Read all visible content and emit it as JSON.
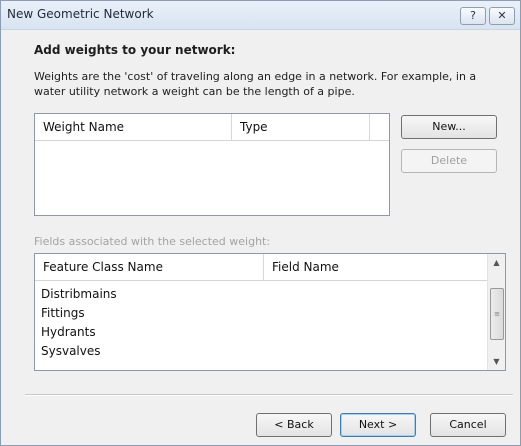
{
  "window": {
    "title": "New Geometric Network",
    "help_icon": "?",
    "close_icon": "✕"
  },
  "weights_section": {
    "heading": "Add weights to your network:",
    "description": "Weights are the 'cost' of traveling along an edge in a network. For example, in a water utility network a weight can be the length of a pipe.",
    "columns": [
      "Weight Name",
      "Type"
    ],
    "rows": [],
    "new_button": "New...",
    "delete_button": "Delete"
  },
  "fields_section": {
    "label": "Fields associated with the selected weight:",
    "columns": [
      "Feature Class Name",
      "Field Name"
    ],
    "rows": [
      {
        "feature_class": "Distribmains",
        "field": ""
      },
      {
        "feature_class": "Fittings",
        "field": ""
      },
      {
        "feature_class": "Hydrants",
        "field": ""
      },
      {
        "feature_class": "Sysvalves",
        "field": ""
      }
    ],
    "scroll_up": "▲",
    "scroll_down": "▼",
    "scroll_grip": "≡"
  },
  "footer": {
    "back_button": "< Back",
    "next_button": "Next >",
    "cancel_button": "Cancel"
  }
}
